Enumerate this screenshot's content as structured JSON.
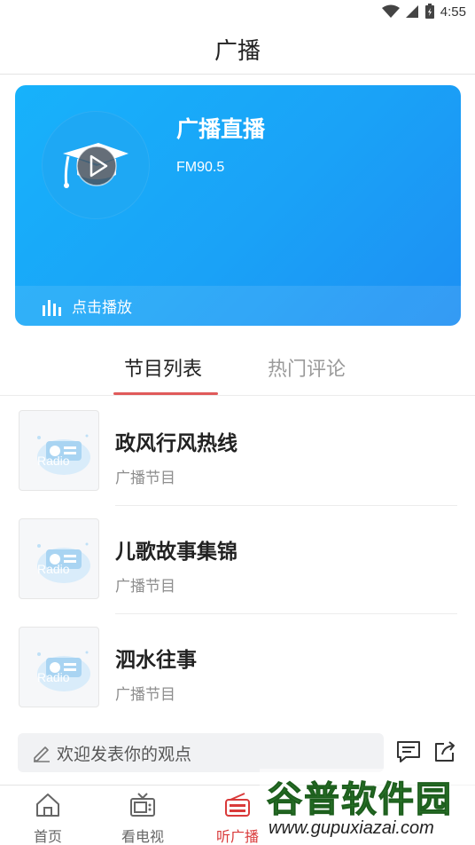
{
  "status_bar": {
    "time": "4:55"
  },
  "app_bar": {
    "title": "广播"
  },
  "live": {
    "title": "广播直播",
    "frequency": "FM90.5",
    "play_label": "点击播放"
  },
  "tabs": [
    {
      "label": "节目列表",
      "active": true
    },
    {
      "label": "热门评论",
      "active": false
    }
  ],
  "programs": [
    {
      "title": "政风行风热线",
      "subtitle": "广播节目",
      "thumb_text": "Radio"
    },
    {
      "title": "儿歌故事集锦",
      "subtitle": "广播节目",
      "thumb_text": "Radio"
    },
    {
      "title": "泗水往事",
      "subtitle": "广播节目",
      "thumb_text": "Radio"
    }
  ],
  "comment_bar": {
    "placeholder": "欢迎发表你的观点"
  },
  "bottom_nav": [
    {
      "label": "首页",
      "icon": "home-icon"
    },
    {
      "label": "看电视",
      "icon": "tv-icon"
    },
    {
      "label": "听广播",
      "icon": "radio-icon",
      "active": true
    }
  ],
  "watermark": {
    "main": "谷普软件园",
    "url": "www.gupuxiazai.com"
  },
  "colors": {
    "accent": "#1aa2f7",
    "active_nav": "#d93a3a",
    "tab_underline": "#e05a5a"
  }
}
